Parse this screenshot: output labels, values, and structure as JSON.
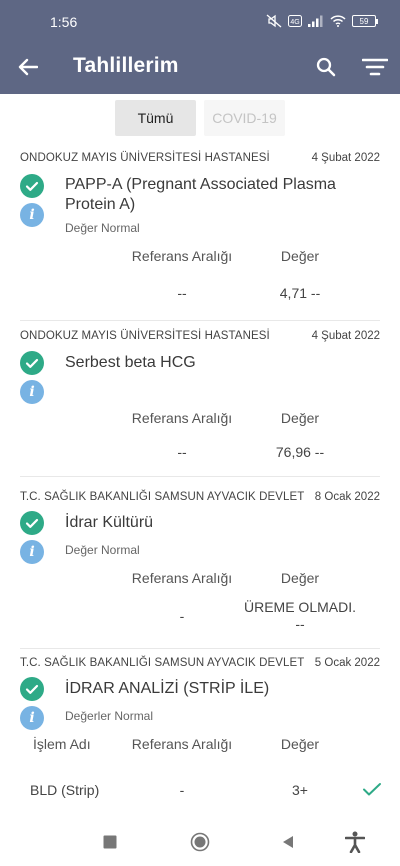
{
  "status_bar": {
    "time": "1:56",
    "battery": "59"
  },
  "header": {
    "title": "Tahlillerim"
  },
  "tabs": [
    {
      "label": "Tümü"
    },
    {
      "label": "COVID-19"
    }
  ],
  "results": [
    {
      "hospital": "ONDOKUZ MAYIS ÜNİVERSİTESİ HASTANESİ",
      "date": "4 Şubat 2022",
      "test_name": "PAPP-A (Pregnant Associated Plasma Protein A)",
      "status": "Değer Normal",
      "ref_header": "Referans Aralığı",
      "value_header": "Değer",
      "ref_value": "--",
      "value": "4,71 --"
    },
    {
      "hospital": "ONDOKUZ MAYIS ÜNİVERSİTESİ HASTANESİ",
      "date": "4 Şubat 2022",
      "test_name": "Serbest beta HCG",
      "status": "",
      "ref_header": "Referans Aralığı",
      "value_header": "Değer",
      "ref_value": "--",
      "value": "76,96 --"
    },
    {
      "hospital": "T.C. SAĞLIK BAKANLIĞI SAMSUN AYVACIK DEVLET",
      "date": "8 Ocak 2022",
      "test_name": "İdrar Kültürü",
      "status": "Değer Normal",
      "ref_header": "Referans Aralığı",
      "value_header": "Değer",
      "ref_value": "-",
      "value_line1": "ÜREME OLMADI.",
      "value_line2": "--"
    },
    {
      "hospital": "T.C. SAĞLIK BAKANLIĞI SAMSUN AYVACIK DEVLET",
      "date": "5 Ocak 2022",
      "test_name": "İDRAR ANALİZİ (STRİP İLE)",
      "status": "Değerler Normal",
      "proc_header": "İşlem Adı",
      "ref_header": "Referans Aralığı",
      "value_header": "Değer",
      "rows": [
        {
          "proc": "BLD (Strip)",
          "ref": "-",
          "value": "3+"
        }
      ]
    }
  ]
}
